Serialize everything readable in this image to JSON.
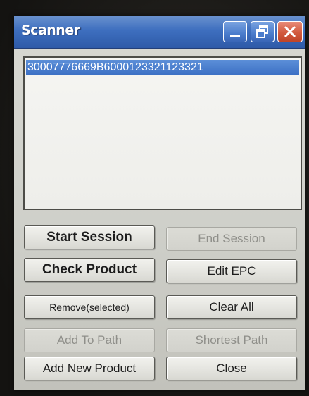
{
  "window": {
    "title": "Scanner"
  },
  "list": {
    "items": [
      {
        "text": "30007776669B6000123321123321",
        "selected": true
      }
    ]
  },
  "buttons": {
    "start_session": "Start Session",
    "end_session": "End Session",
    "check_product": "Check Product",
    "edit_epc": "Edit EPC",
    "remove_selected": "Remove(selected)",
    "clear_all": "Clear All",
    "add_to_path": "Add To Path",
    "shortest_path": "Shortest Path",
    "add_new_product": "Add New Product",
    "close": "Close"
  },
  "colors": {
    "titlebar": "#3e6fbf",
    "selection": "#3b6fc4",
    "close_button": "#d25a3e",
    "disabled_text": "#8f8f8a"
  },
  "icons": {
    "minimize": "minimize-icon",
    "maximize": "maximize-icon",
    "close": "close-icon"
  }
}
